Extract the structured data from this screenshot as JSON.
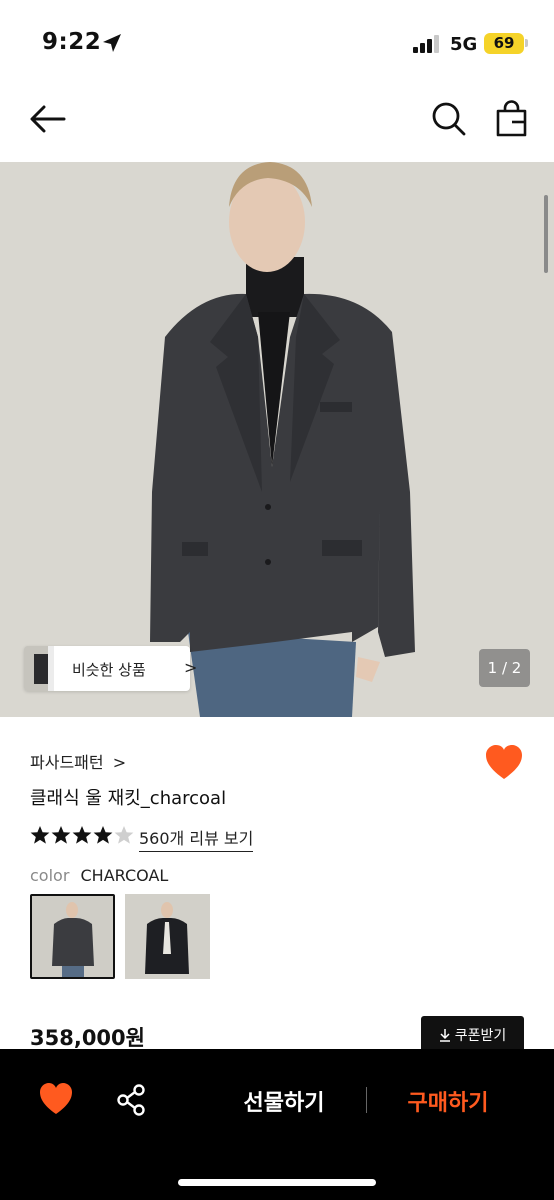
{
  "status_bar": {
    "time": "9:22",
    "network": "5G",
    "battery": "69"
  },
  "header": {
    "back_icon": "arrow-left-icon",
    "search_icon": "search-icon",
    "bag_icon": "shopping-bag-icon"
  },
  "gallery": {
    "similar_label": "비슷한 상품",
    "similar_chevron": ">",
    "counter": "1 / 2",
    "current_image": 1,
    "total_images": 2
  },
  "product": {
    "brand": "파사드패턴",
    "brand_chevron": ">",
    "name": "클래식 울 재킷_charcoal",
    "rating": 4.5,
    "stars_text": "★★★★★",
    "review_link": "560개 리뷰 보기",
    "color_label": "color",
    "color_value": "CHARCOAL",
    "price": "358,000원",
    "coupon_label": "쿠폰받기",
    "liked": true
  },
  "bottom_bar": {
    "gift_label": "선물하기",
    "buy_label": "구매하기"
  },
  "colors": {
    "accent_orange": "#ff5a1f",
    "black": "#111111",
    "background": "#ffffff"
  }
}
